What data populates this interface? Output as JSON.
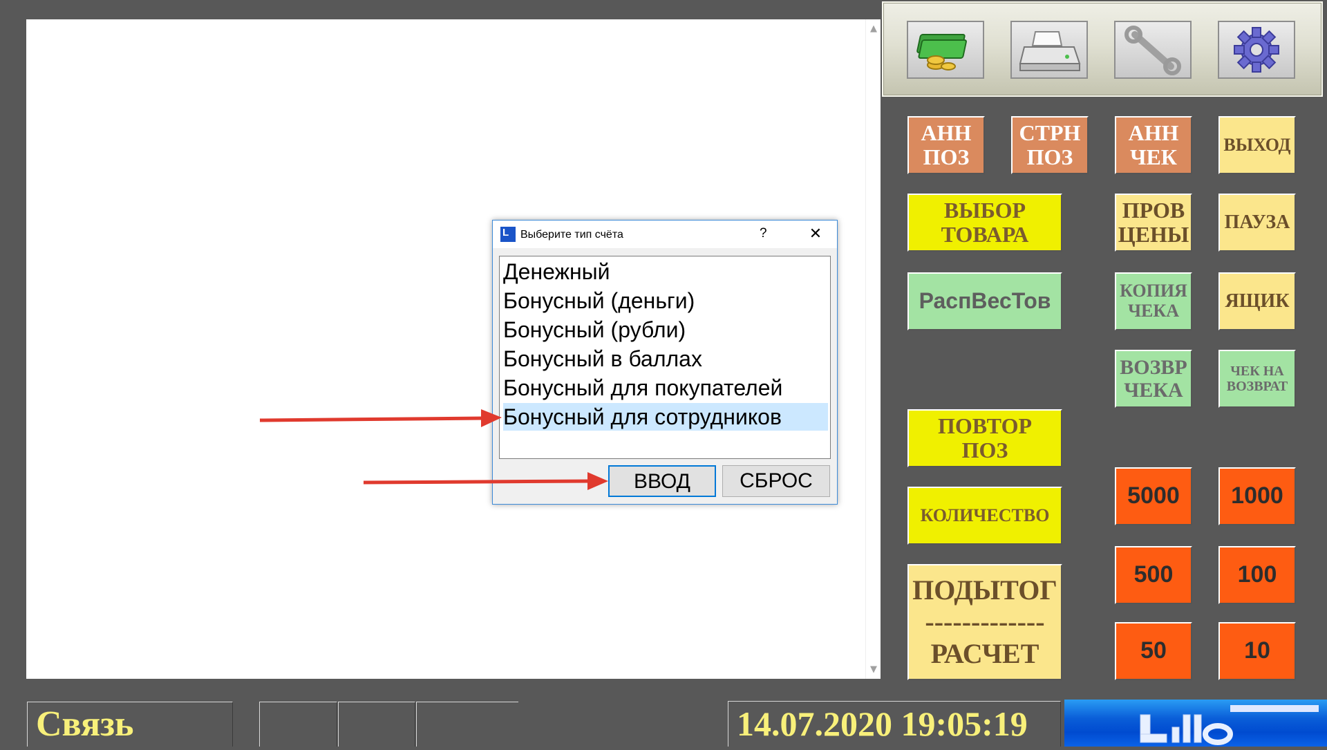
{
  "toolbar": {
    "icons": [
      "money-icon",
      "printer-icon",
      "wrench-icon",
      "gear-icon"
    ]
  },
  "buttons": {
    "ann_pos": [
      "АНН",
      "ПОЗ"
    ],
    "strn_pos": [
      "СТРН",
      "ПОЗ"
    ],
    "ann_check": [
      "АНН",
      "ЧЕК"
    ],
    "exit": "ВЫХОД",
    "select_item": [
      "ВЫБОР",
      "ТОВАРА"
    ],
    "price_check": [
      "ПРОВ",
      "ЦЕНЫ"
    ],
    "pause": "ПАУЗА",
    "rasp_ves": "РаспВесТов",
    "copy_check": [
      "КОПИЯ",
      "ЧЕКА"
    ],
    "drawer": "ЯЩИК",
    "return_check": [
      "ВОЗВР",
      "ЧЕКА"
    ],
    "check_return": [
      "ЧЕК НА",
      "ВОЗВРАТ"
    ],
    "repeat_pos": [
      "ПОВТОР",
      "ПОЗ"
    ],
    "quantity": "КОЛИЧЕСТВО",
    "subtotal": [
      "ПОДЫТОГ",
      "-------------",
      "РАСЧЕТ"
    ],
    "n5000": "5000",
    "n1000": "1000",
    "n500": "500",
    "n100": "100",
    "n50": "50",
    "n10": "10"
  },
  "dialog": {
    "title": "Выберите тип счёта",
    "help": "?",
    "close": "✕",
    "items": [
      "Денежный",
      "Бонусный (деньги)",
      "Бонусный (рубли)",
      "Бонусный в баллах",
      "Бонусный для покупателей",
      "Бонусный для сотрудников"
    ],
    "selected_index": 5,
    "enter_label": "ВВОД",
    "reset_label": "СБРОС"
  },
  "status": {
    "link": "Связь",
    "datetime": "14.07.2020 19:05:19"
  },
  "colors": {
    "annotation_arrow": "#e03a2e",
    "background": "#585858",
    "datetime_text": "#f8f07a"
  }
}
